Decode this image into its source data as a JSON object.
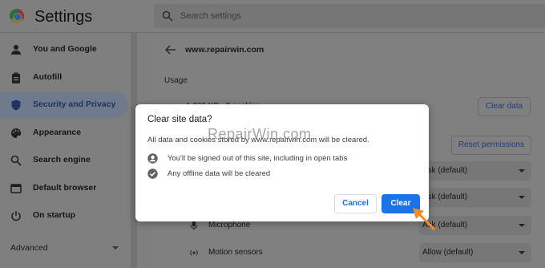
{
  "header": {
    "title": "Settings",
    "search_placeholder": "Search settings"
  },
  "sidebar": {
    "items": [
      {
        "label": "You and Google",
        "icon": "person-icon"
      },
      {
        "label": "Autofill",
        "icon": "clipboard-icon"
      },
      {
        "label": "Security and Privacy",
        "icon": "shield-icon",
        "active": true
      },
      {
        "label": "Appearance",
        "icon": "palette-icon"
      },
      {
        "label": "Search engine",
        "icon": "search-icon"
      },
      {
        "label": "Default browser",
        "icon": "browser-icon"
      },
      {
        "label": "On startup",
        "icon": "power-icon"
      }
    ],
    "advanced_label": "Advanced"
  },
  "content": {
    "site": "www.repairwin.com",
    "usage_label": "Usage",
    "usage_value": "1,309 KB · 3 cookies",
    "clear_data_label": "Clear data",
    "reset_permissions_label": "Reset permissions",
    "permissions": [
      {
        "label": "",
        "value": "Ask (default)"
      },
      {
        "label": "",
        "value": "Ask (default)"
      },
      {
        "label": "Microphone",
        "value": "Ask (default)",
        "icon": "microphone-icon"
      },
      {
        "label": "Motion sensors",
        "value": "Allow (default)",
        "icon": "sensors-icon"
      }
    ]
  },
  "dialog": {
    "title": "Clear site data?",
    "description": "All data and cookies stored by www.repairwin.com will be cleared.",
    "items": [
      {
        "text": "You'll be signed out of this site, including in open tabs",
        "icon": "account-icon"
      },
      {
        "text": "Any offline data will be cleared",
        "icon": "offline-check-icon"
      }
    ],
    "cancel_label": "Cancel",
    "clear_label": "Clear",
    "watermark": "RepairWin.com"
  },
  "colors": {
    "accent": "#1a73e8",
    "annotation_arrow": "#f28c28"
  }
}
